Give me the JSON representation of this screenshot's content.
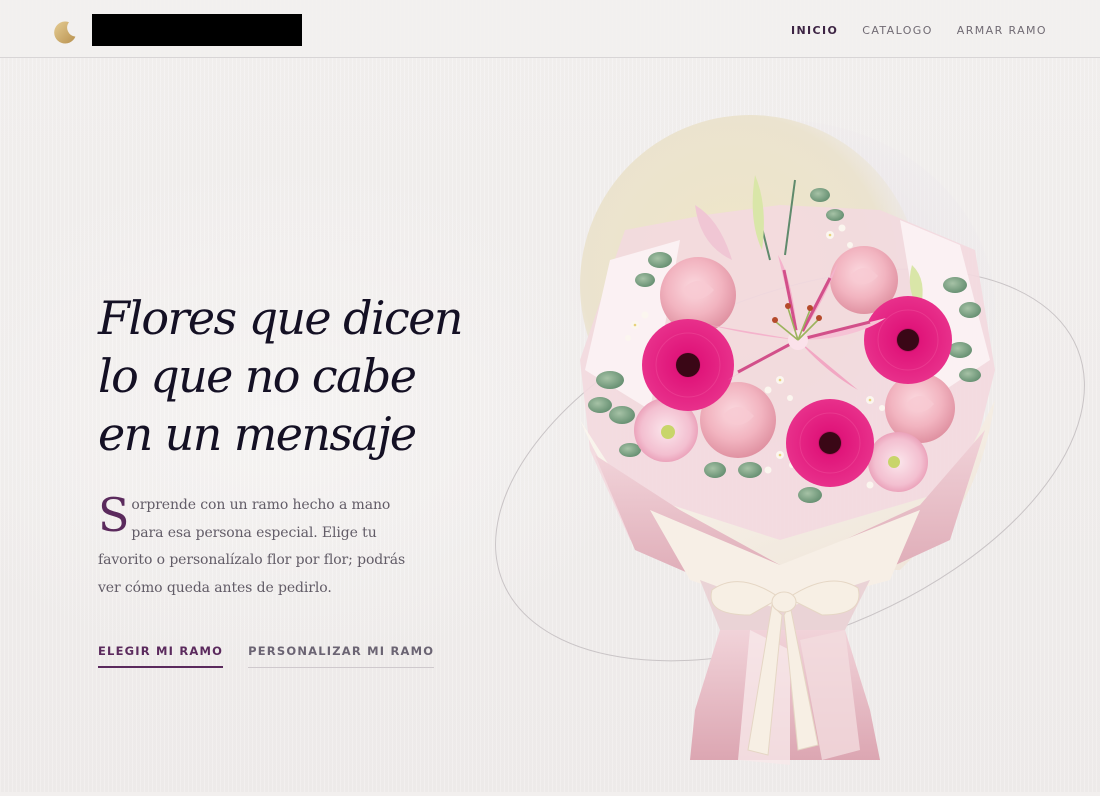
{
  "header": {
    "brand_name": "",
    "nav": [
      {
        "label": "INICIO",
        "active": true
      },
      {
        "label": "CATALOGO",
        "active": false
      },
      {
        "label": "ARMAR RAMO",
        "active": false
      }
    ]
  },
  "hero": {
    "title_lines": [
      "Flores que dicen",
      "lo que no cabe",
      "en un mensaje"
    ],
    "copy_dropcap": "S",
    "copy_text": "orprende con un ramo hecho a mano para esa persona especial. Elige tu favorito o personalízalo flor por flor; podrás ver cómo queda antes de pedirlo.",
    "cta_primary": "ELEGIR MI RAMO",
    "cta_secondary": "PERSONALIZAR MI RAMO"
  },
  "icons": {
    "logo": "crescent-moon-icon"
  },
  "colors": {
    "accent": "#5b2a5d",
    "title": "#141024",
    "body_text": "#625c67",
    "logo_gold": "#cfae6b",
    "background": "#f2efee"
  }
}
